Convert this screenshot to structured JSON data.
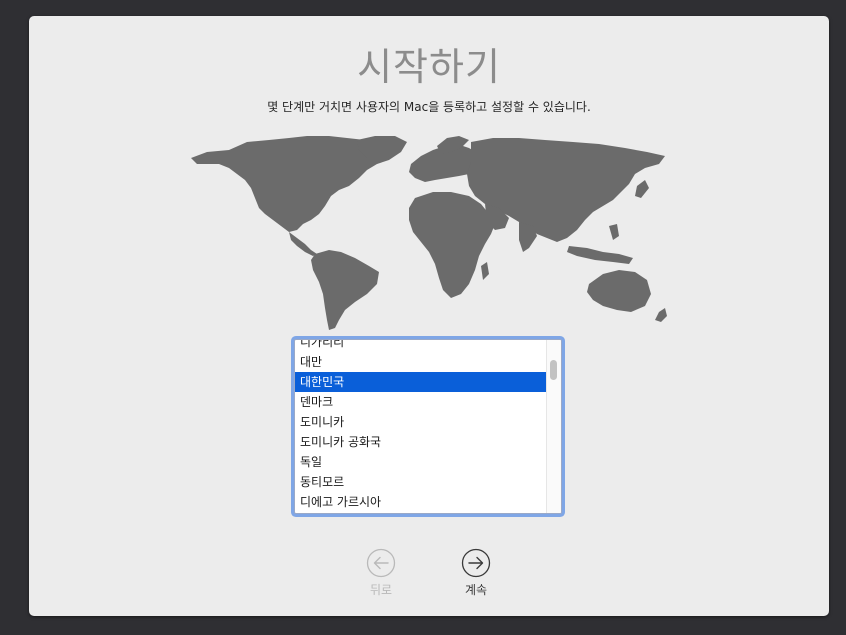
{
  "setup": {
    "title": "시작하기",
    "subtitle": "몇 단계만 거치면 사용자의 Mac을 등록하고 설정할 수 있습니다."
  },
  "country_list": {
    "items": [
      "디가리리",
      "대만",
      "대한민국",
      "덴마크",
      "도미니카",
      "도미니카 공화국",
      "독일",
      "동티모르",
      "디에고 가르시아"
    ],
    "selected": "대한민국"
  },
  "nav": {
    "back_label": "뒤로",
    "continue_label": "계속"
  },
  "colors": {
    "selection": "#0a5fd9",
    "map_land": "#6b6b6b",
    "focus_ring": "#7fa6e6"
  }
}
